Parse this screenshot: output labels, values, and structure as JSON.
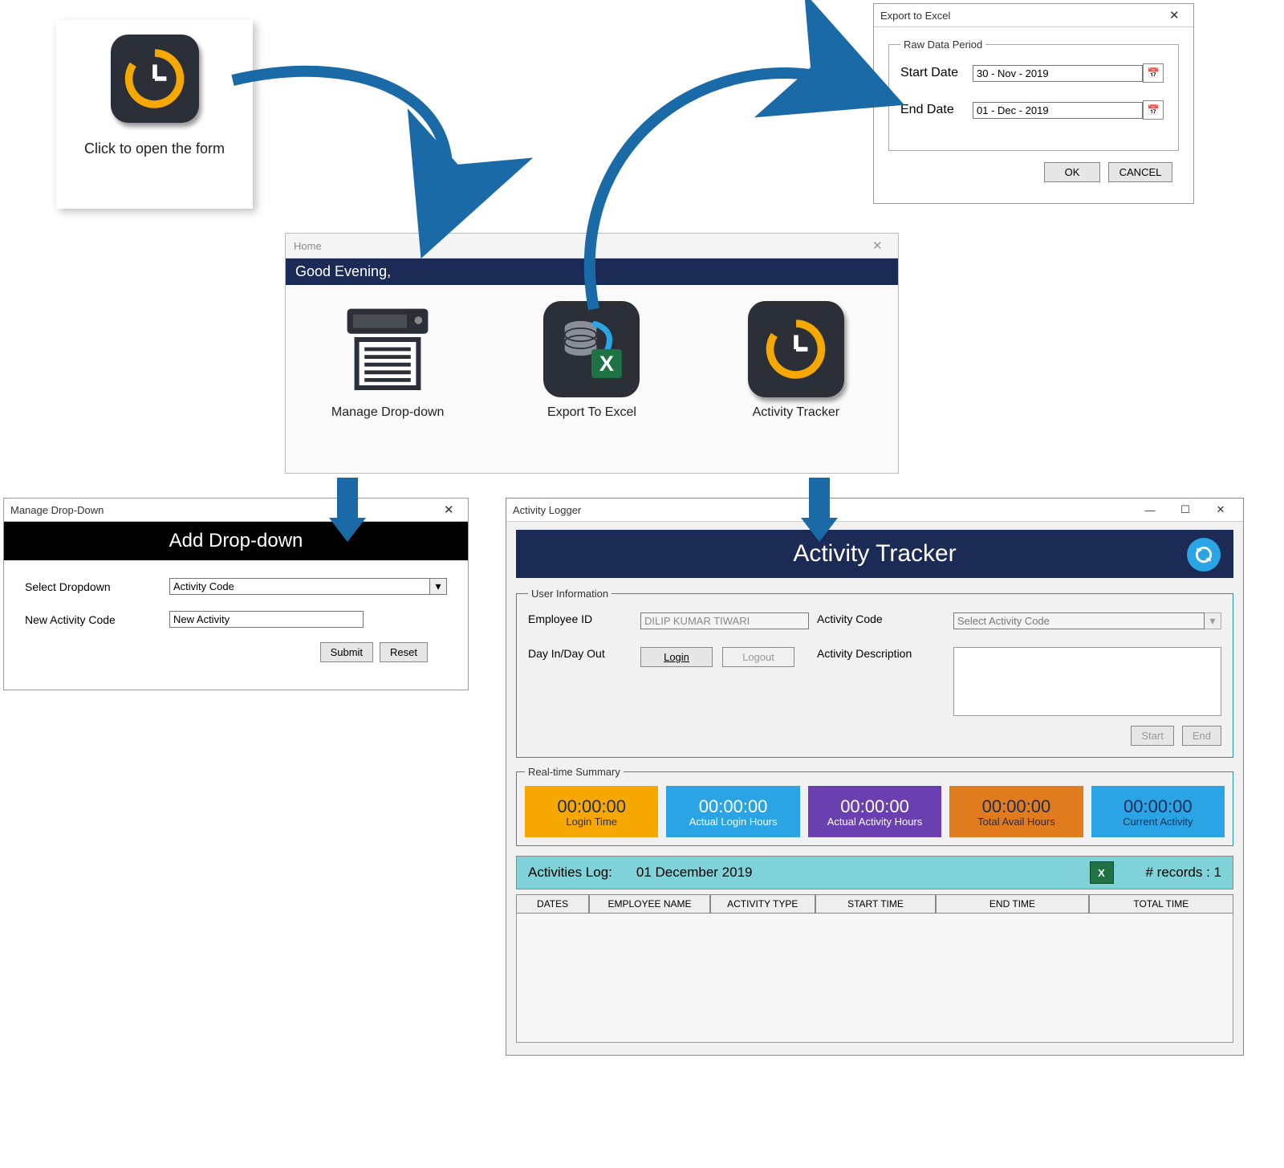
{
  "launcher": {
    "caption": "Click to open the form"
  },
  "export": {
    "title": "Export to Excel",
    "group": "Raw Data Period",
    "start_label": "Start Date",
    "start_value": "30 - Nov - 2019",
    "end_label": "End Date",
    "end_value": "01 - Dec - 2019",
    "ok": "OK",
    "cancel": "CANCEL"
  },
  "home": {
    "title": "Home",
    "greeting": "Good Evening,",
    "tiles": {
      "manage": "Manage Drop-down",
      "export": "Export To Excel",
      "tracker": "Activity Tracker"
    }
  },
  "manage": {
    "title": "Manage Drop-Down",
    "header": "Add Drop-down",
    "select_label": "Select Dropdown",
    "select_value": "Activity Code",
    "new_label": "New Activity Code",
    "new_value": "New Activity",
    "submit": "Submit",
    "reset": "Reset"
  },
  "logger": {
    "title": "Activity Logger",
    "header": "Activity Tracker",
    "user_group": "User Information",
    "emp_label": "Employee ID",
    "emp_value": "DILIP KUMAR TIWARI",
    "dayio_label": "Day In/Day Out",
    "login_btn": "Login",
    "logout_btn": "Logout",
    "actcode_label": "Activity Code",
    "actcode_ph": "Select Activity Code",
    "actdesc_label": "Activity Description",
    "start_btn": "Start",
    "end_btn": "End",
    "rt_group": "Real-time Summary",
    "rt": [
      {
        "time": "00:00:00",
        "label": "Login Time",
        "bg": "#f7a800",
        "fg": "#1c2b55"
      },
      {
        "time": "00:00:00",
        "label": "Actual Login Hours",
        "bg": "#2aa4e5",
        "fg": "#fff"
      },
      {
        "time": "00:00:00",
        "label": "Actual Activity Hours",
        "bg": "#6a3fb0",
        "fg": "#fff"
      },
      {
        "time": "00:00:00",
        "label": "Total Avail Hours",
        "bg": "#e07c1e",
        "fg": "#1c2b55"
      },
      {
        "time": "00:00:00",
        "label": "Current Activity",
        "bg": "#2aa4e5",
        "fg": "#1c2b55"
      }
    ],
    "log_label": "Activities Log:",
    "log_date": "01 December 2019",
    "records": "# records : 1",
    "cols": [
      "DATES",
      "EMPLOYEE NAME",
      "ACTIVITY TYPE",
      "START TIME",
      "END TIME",
      "TOTAL TIME"
    ]
  }
}
